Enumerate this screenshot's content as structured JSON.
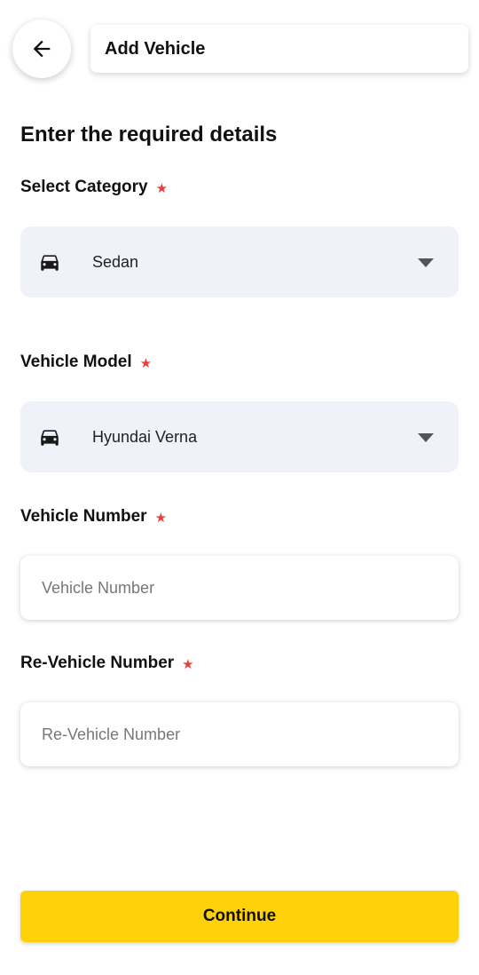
{
  "header": {
    "title": "Add Vehicle",
    "back_icon": "arrow-left-icon"
  },
  "form": {
    "heading": "Enter the required details",
    "required_marker": "★",
    "category": {
      "label": "Select Category",
      "value": "Sedan",
      "icon": "car-icon"
    },
    "model": {
      "label": "Vehicle Model",
      "value": "Hyundai Verna",
      "icon": "car-icon"
    },
    "vehicle_number": {
      "label": "Vehicle Number",
      "placeholder": "Vehicle Number",
      "value": ""
    },
    "re_vehicle_number": {
      "label": "Re-Vehicle Number",
      "placeholder": "Re-Vehicle Number",
      "value": ""
    }
  },
  "actions": {
    "continue_label": "Continue"
  },
  "colors": {
    "accent": "#ffd10a",
    "required_star": "#e8413c",
    "dropdown_bg": "#eff2f8"
  }
}
